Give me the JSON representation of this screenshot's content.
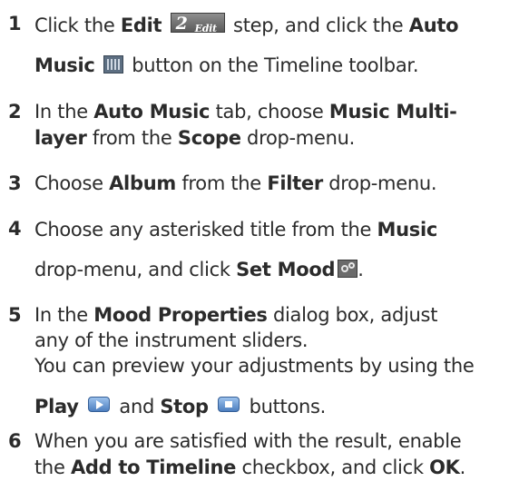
{
  "steps": [
    {
      "number": "1",
      "t1": "Click the ",
      "b1": "Edit",
      "icon1": "edit-step-icon",
      "icon1_number": "2",
      "icon1_text": "Edit",
      "t2": " step, and click the ",
      "b2": "Auto",
      "b3": "Music",
      "icon2": "auto-music-icon",
      "t3": " button on the Timeline toolbar."
    },
    {
      "number": "2",
      "t1": "In the ",
      "b1": "Auto Music",
      "t2": " tab, choose ",
      "b2": "Music Multi-",
      "b3": "layer",
      "t3": " from the ",
      "b4": "Scope",
      "t4": " drop-menu."
    },
    {
      "number": "3",
      "t1": "Choose ",
      "b1": "Album",
      "t2": " from the ",
      "b2": "Filter",
      "t3": " drop-menu."
    },
    {
      "number": "4",
      "t1": "Choose any asterisked title from the ",
      "b1": "Music",
      "t2": "drop-menu, and click ",
      "b2": "Set Mood",
      "icon1": "set-mood-icon",
      "t3": "."
    },
    {
      "number": "5",
      "t1": "In the ",
      "b1": "Mood Properties",
      "t2": " dialog box, adjust",
      "t3": "any of the instrument sliders.",
      "t4": "You can preview your adjustments by using the",
      "b2": "Play",
      "icon1": "play-icon",
      "t5": " and ",
      "b3": "Stop",
      "icon2": "stop-icon",
      "t6": " buttons."
    },
    {
      "number": "6",
      "t1": "When you are satisfied with the result, enable",
      "t2": "the ",
      "b1": "Add to Timeline",
      "t3": " checkbox, and click ",
      "b2": "OK",
      "t4": "."
    }
  ]
}
